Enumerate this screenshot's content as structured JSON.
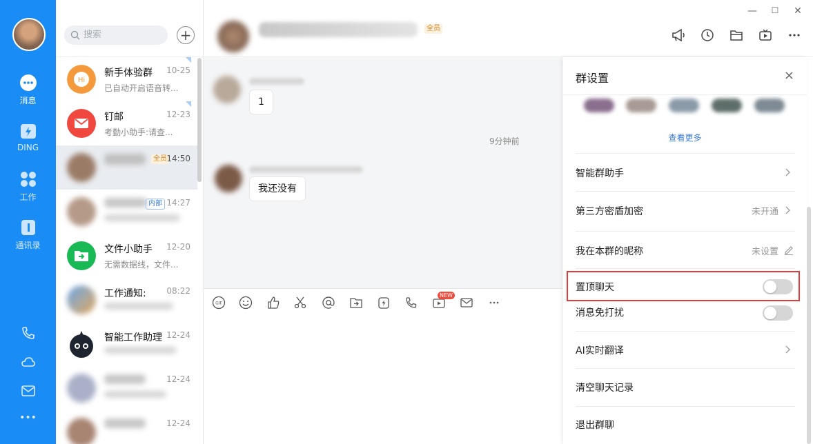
{
  "nav": {
    "items": [
      {
        "label": "消息",
        "icon": "chat-bubble-icon"
      },
      {
        "label": "DING",
        "icon": "ding-icon"
      },
      {
        "label": "工作",
        "icon": "apps-grid-icon"
      },
      {
        "label": "通讯录",
        "icon": "contacts-icon"
      }
    ],
    "bottom_icons": [
      "phone-icon",
      "cloud-icon",
      "mail-icon",
      "more-icon"
    ],
    "more_label": "•••"
  },
  "list": {
    "search_placeholder": "搜索",
    "add_label": "+",
    "chats": [
      {
        "name": "新手体验群",
        "time": "10-25",
        "preview": "已自动开启语音转..."
      },
      {
        "name": "钉邮",
        "time": "12-23",
        "preview": "考勤小助手:请查..."
      },
      {
        "name": "",
        "time": "14:50",
        "tag": "全员"
      },
      {
        "name": "",
        "time": "14:27",
        "tag": "内部"
      },
      {
        "name": "文件小助手",
        "time": "12-20",
        "preview": "无需数据线，文件..."
      },
      {
        "name": "工作通知:",
        "time": "08:22",
        "preview": ""
      },
      {
        "name": "智能工作助理",
        "time": "12-24",
        "preview": ""
      },
      {
        "name": "",
        "time": "12-24",
        "preview": ""
      },
      {
        "name": "",
        "time": "12-24",
        "preview": ""
      }
    ]
  },
  "header": {
    "tag": "全员",
    "window_controls": [
      "—",
      "☐",
      "✕"
    ]
  },
  "messages": {
    "msg1": "1",
    "timestamp": "9分钟前",
    "msg2": "我还没有"
  },
  "toolbar": {
    "gif_label": "GIF",
    "new_badge": "NEW"
  },
  "panel": {
    "title": "群设置",
    "close_label": "×",
    "see_more": "查看更多",
    "rows": {
      "assistant": "智能群助手",
      "encrypt": "第三方密盾加密",
      "encrypt_value": "未开通",
      "nickname": "我在本群的昵称",
      "nickname_value": "未设置",
      "pin": "置顶聊天",
      "mute": "消息免打扰",
      "translate": "AI实时翻译",
      "clear": "清空聊天记录",
      "exit": "退出群聊"
    }
  }
}
